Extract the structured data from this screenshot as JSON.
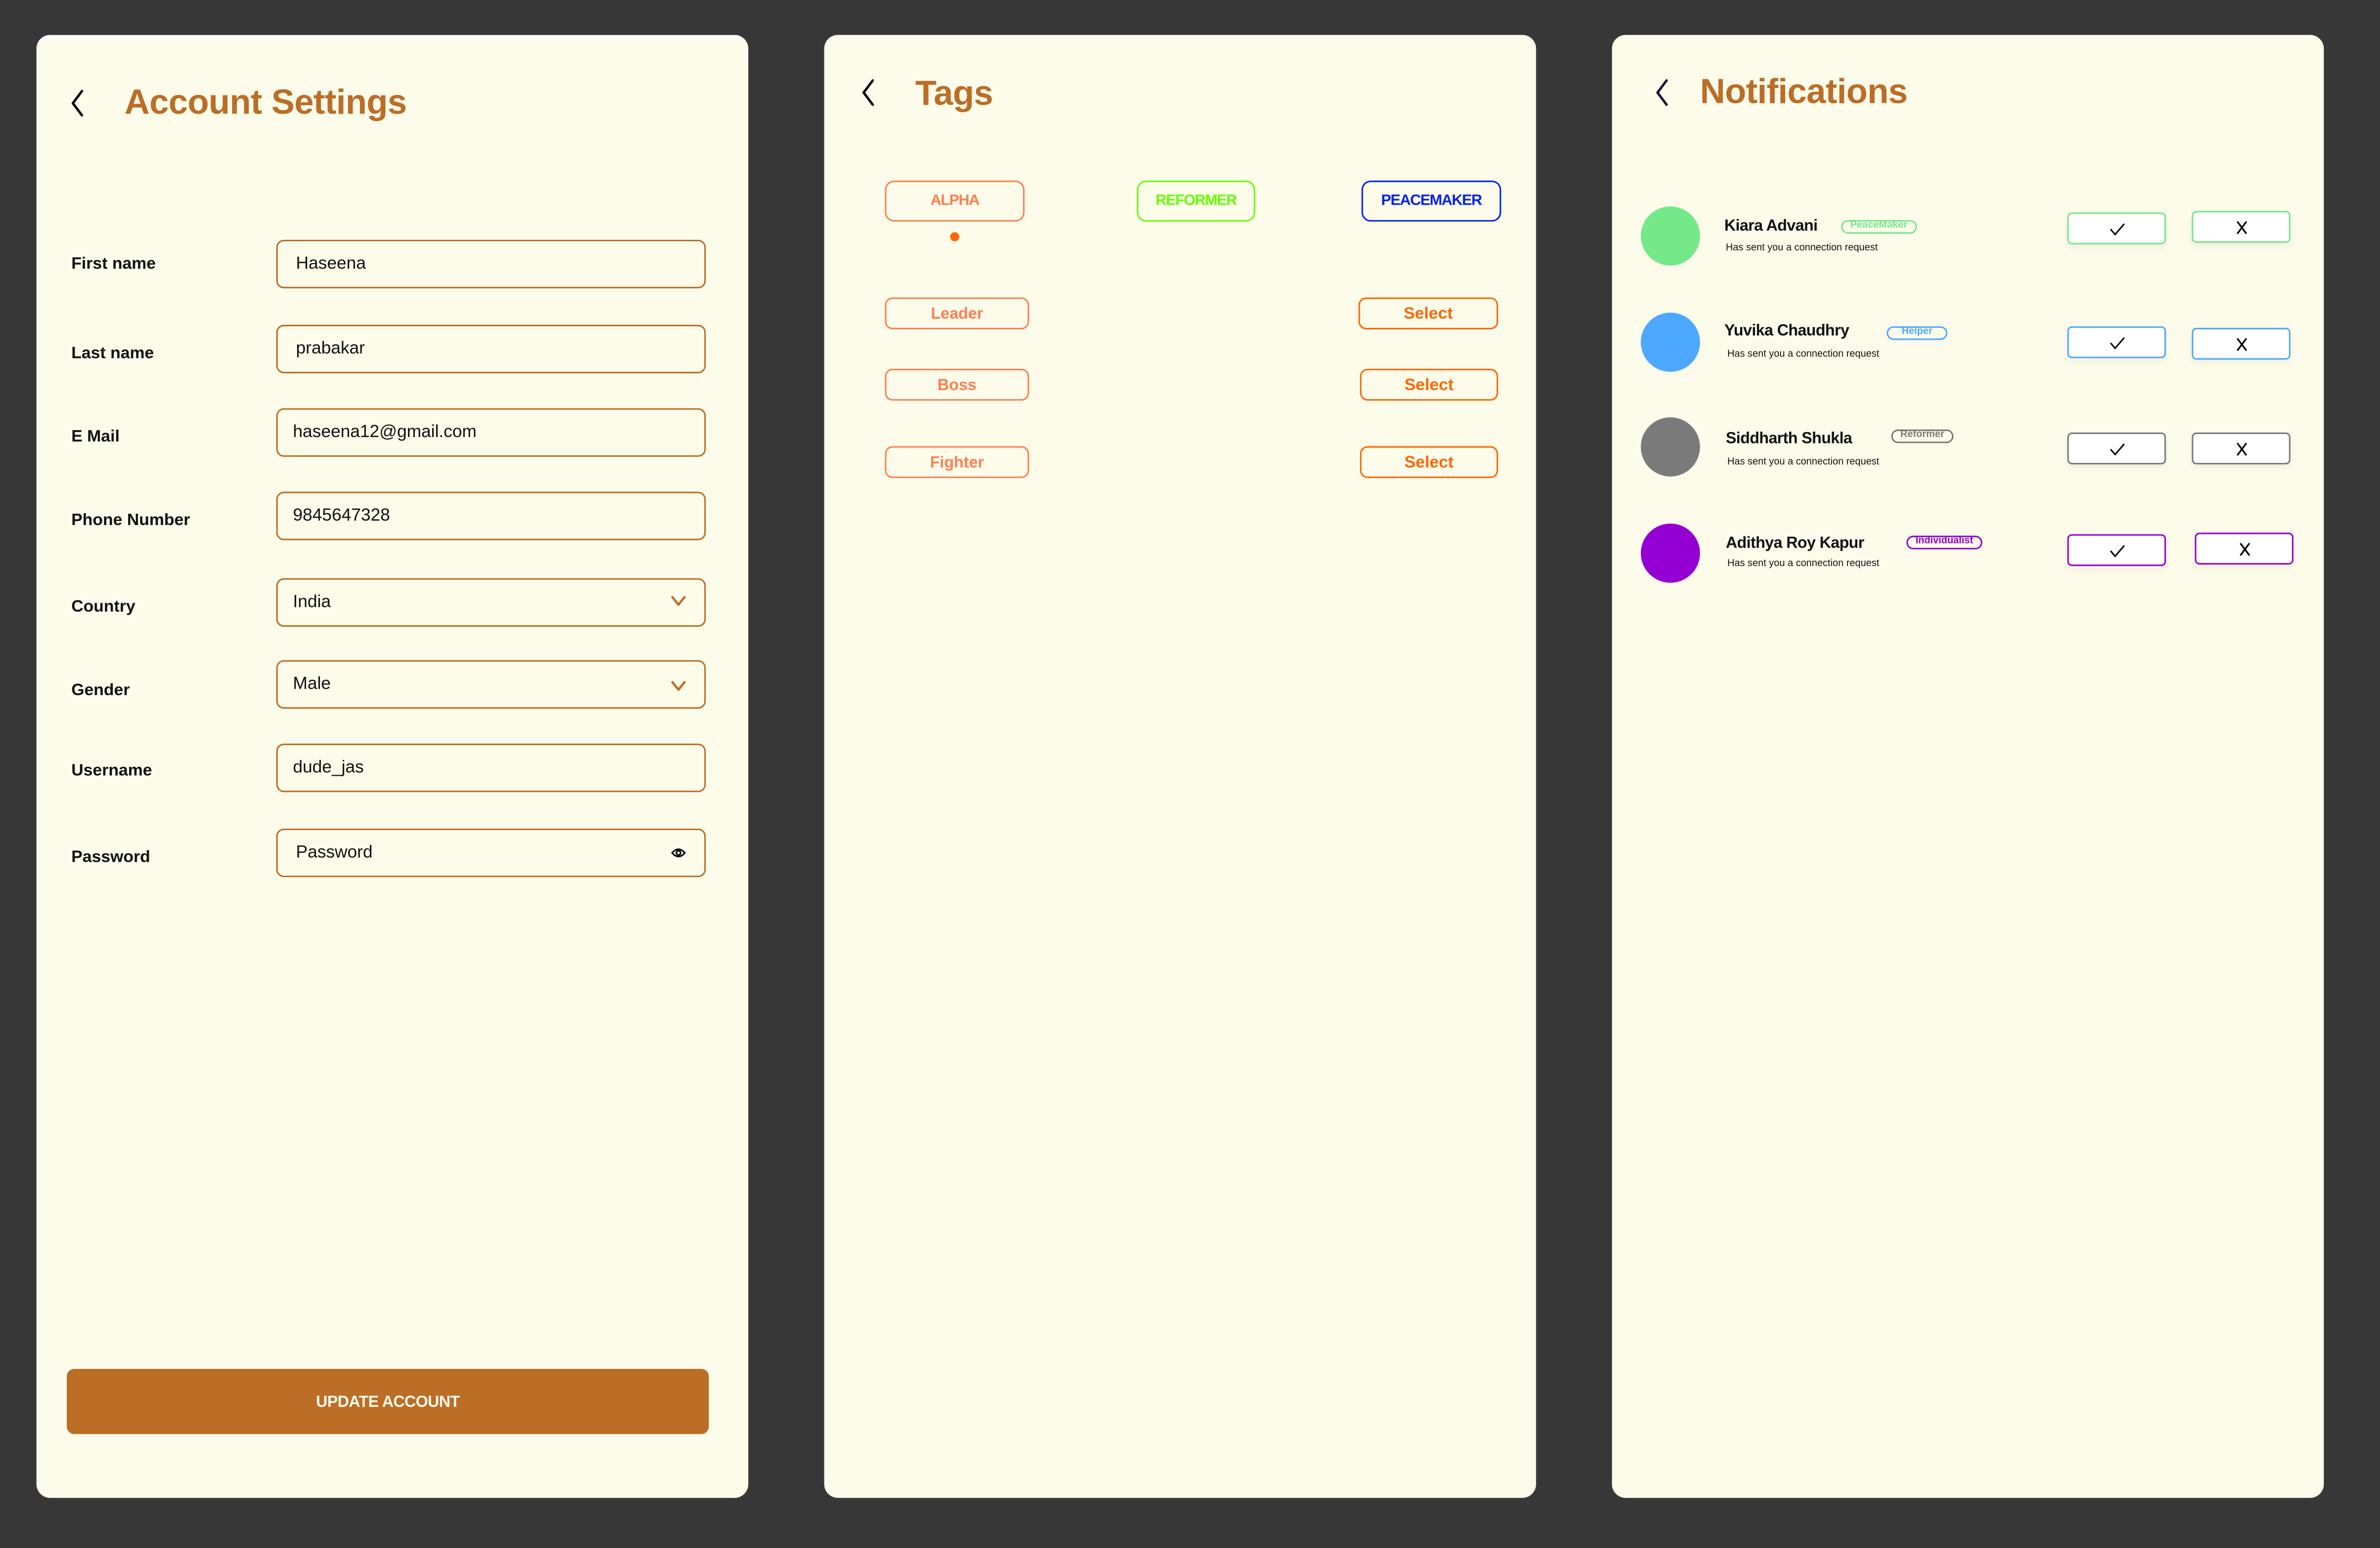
{
  "colors": {
    "background": "#373737",
    "panel": "#FDFCEB",
    "accent": "#BC6D26",
    "tag_orange": "#FF7F50",
    "select_orange": "#FF6600"
  },
  "account": {
    "title": "Account Settings",
    "back_icon": "chevron-left-icon",
    "fields": [
      {
        "label": "First name",
        "value": "Haseena",
        "type": "text"
      },
      {
        "label": "Last name",
        "value": "prabakar",
        "type": "text"
      },
      {
        "label": "E Mail",
        "value": "haseena12@gmail.com",
        "type": "text"
      },
      {
        "label": "Phone Number",
        "value": "9845647328",
        "type": "text"
      },
      {
        "label": "Country",
        "value": "India",
        "type": "select",
        "icon": "chevron-down-icon"
      },
      {
        "label": "Gender",
        "value": "Male",
        "type": "select",
        "icon": "chevron-down-icon"
      },
      {
        "label": "Username",
        "value": "dude_jas",
        "type": "text"
      },
      {
        "label": "Password",
        "value": "",
        "placeholder": "Password",
        "type": "password",
        "icon": "eye-icon"
      }
    ],
    "update_button": "UPDATE ACCOUNT"
  },
  "tags": {
    "title": "Tags",
    "back_icon": "chevron-left-icon",
    "top_tags": [
      {
        "label": "ALPHA",
        "color": "#FF7F50",
        "selected": true
      },
      {
        "label": "REFORMER",
        "color": "#66FF00",
        "selected": false
      },
      {
        "label": "PEACEMAKER",
        "color": "#0022EE",
        "selected": false
      }
    ],
    "rows": [
      {
        "label": "Leader",
        "action": "Select"
      },
      {
        "label": "Boss",
        "action": "Select"
      },
      {
        "label": "Fighter",
        "action": "Select"
      }
    ]
  },
  "notifications": {
    "title": "Notifications",
    "back_icon": "chevron-left-icon",
    "items": [
      {
        "name": "Kiara Advani",
        "badge": "PeaceMaker",
        "message": "Has sent you a connection request",
        "color": "#75E88A",
        "accept_icon": "check-icon",
        "reject_icon": "close-icon"
      },
      {
        "name": "Yuvika Chaudhry",
        "badge": "Helper",
        "message": "Has sent you a connection request",
        "color": "#4DA8FF",
        "accept_icon": "check-icon",
        "reject_icon": "close-icon"
      },
      {
        "name": "Siddharth Shukla",
        "badge": "Reformer",
        "message": "Has sent you a connection request",
        "color": "#7A7A7A",
        "accept_icon": "check-icon",
        "reject_icon": "close-icon"
      },
      {
        "name": "Adithya Roy Kapur",
        "badge": "Individualist",
        "message": "Has sent you a connection request",
        "color": "#9400D3",
        "accept_icon": "check-icon",
        "reject_icon": "close-icon"
      }
    ]
  }
}
